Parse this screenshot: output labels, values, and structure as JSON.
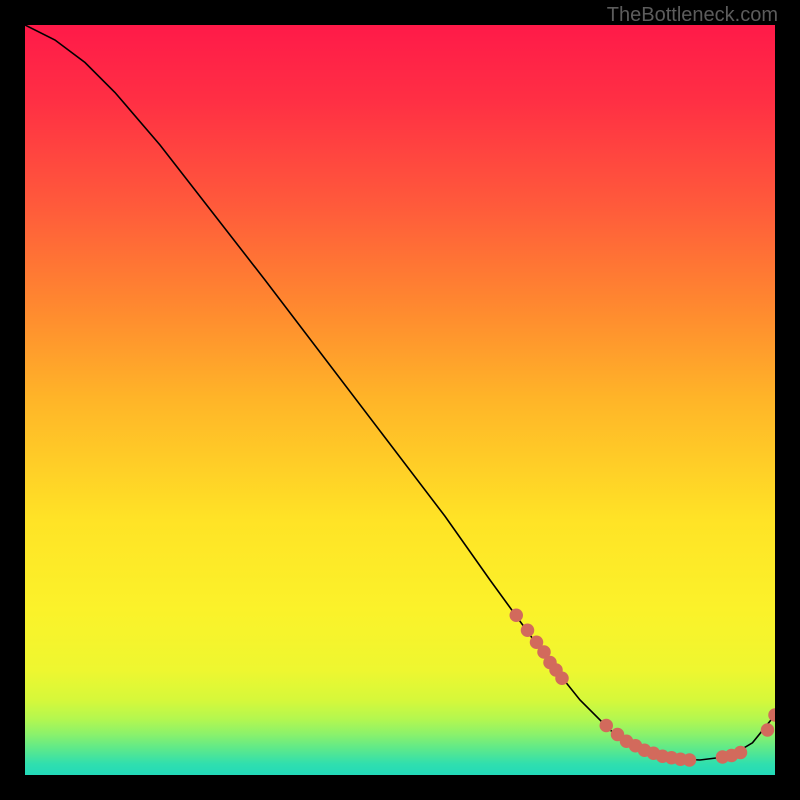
{
  "watermark": "TheBottleneck.com",
  "chart_data": {
    "type": "line",
    "title": "",
    "xlabel": "",
    "ylabel": "",
    "xlim": [
      0,
      100
    ],
    "ylim": [
      0,
      100
    ],
    "series": [
      {
        "name": "curve",
        "x": [
          0,
          4,
          8,
          12,
          18,
          25,
          32,
          40,
          48,
          56,
          62,
          66,
          70,
          74,
          78,
          82,
          86,
          90,
          94,
          97,
          100
        ],
        "values": [
          100,
          98,
          95,
          91,
          84,
          75,
          66,
          55.5,
          45,
          34.5,
          26,
          20.5,
          15,
          10,
          6,
          3.3,
          2.2,
          2.0,
          2.5,
          4.3,
          8.0
        ]
      }
    ],
    "markers": {
      "name": "highlight-points",
      "color": "#d26a5c",
      "x": [
        65.5,
        67.0,
        68.2,
        69.2,
        70.0,
        70.8,
        71.6,
        77.5,
        79.0,
        80.2,
        81.4,
        82.6,
        83.8,
        85.0,
        86.2,
        87.4,
        88.6,
        93.0,
        94.2,
        95.4,
        99.0,
        100.0
      ],
      "values": [
        21.3,
        19.3,
        17.7,
        16.4,
        15.0,
        14.0,
        12.9,
        6.6,
        5.4,
        4.5,
        3.9,
        3.3,
        2.9,
        2.5,
        2.3,
        2.1,
        2.0,
        2.4,
        2.6,
        3.0,
        6.0,
        8.0
      ]
    }
  }
}
